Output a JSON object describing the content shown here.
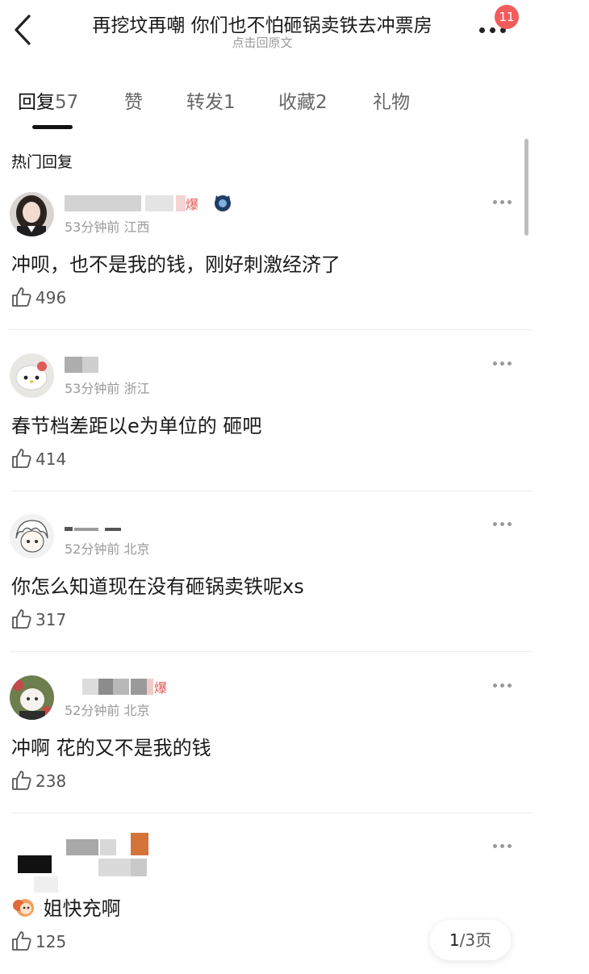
{
  "header": {
    "title": "再挖坟再嘲 你们也不怕砸锅卖铁去冲票房",
    "subtitle": "点击回原文",
    "badge": "11"
  },
  "tabs": [
    {
      "label": "回复",
      "count": "57"
    },
    {
      "label": "赞",
      "count": ""
    },
    {
      "label": "转发",
      "count": "1"
    },
    {
      "label": "收藏",
      "count": "2"
    },
    {
      "label": "礼物",
      "count": ""
    }
  ],
  "section_title": "热门回复",
  "comments": [
    {
      "meta": "53分钟前 江西",
      "text": "冲呗，也不是我的钱，刚好刺激经济了",
      "likes": "496",
      "tag": "爆"
    },
    {
      "meta": "53分钟前 浙江",
      "text": "春节档差距以e为单位的 砸吧",
      "likes": "414"
    },
    {
      "meta": "52分钟前 北京",
      "text": "你怎么知道现在没有砸锅卖铁呢xs",
      "likes": "317"
    },
    {
      "meta": "52分钟前 北京",
      "text": "冲啊  花的又不是我的钱",
      "likes": "238",
      "tag": "爆"
    },
    {
      "meta": "",
      "text": "姐快充啊",
      "likes": "125"
    }
  ],
  "pager": {
    "current": "1",
    "total": "/3页"
  },
  "colors": {
    "badge": "#f25c5c",
    "tag": "#e05a5a",
    "meta": "#9a9a9a"
  }
}
